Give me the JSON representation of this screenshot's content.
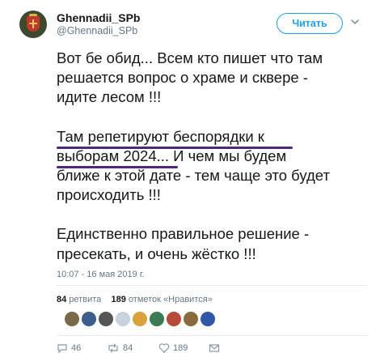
{
  "user": {
    "display_name": "Ghennadii_SPb",
    "handle": "@Ghennadii_SPb",
    "follow_label": "Читать"
  },
  "tweet": {
    "paragraph1": [
      "Вот бе обид... Всем кто пишет что там",
      "решается вопрос о храме и сквере -",
      "идите лесом !!!"
    ],
    "paragraph2": [
      "Там репетируют беспорядки к",
      "выборам 2024... И чем мы будем",
      "ближе к этой дате - тем чаще это будет",
      "происходить !!!"
    ],
    "paragraph3": [
      "Единственно правильное решение -",
      "пресекать, и очень жёстко !!!"
    ],
    "timestamp": "10:07 - 16 мая 2019 г."
  },
  "stats": {
    "retweets_count": "84",
    "retweets_label": "ретвита",
    "likes_count": "189",
    "likes_label": "отметок «Нравится»"
  },
  "likers": [
    {
      "icon": "liker-avatar",
      "color": "#7a6a4a"
    },
    {
      "icon": "liker-avatar",
      "color": "#3b5f8a"
    },
    {
      "icon": "liker-avatar",
      "color": "#555555"
    },
    {
      "icon": "liker-avatar",
      "color": "#c9d3de"
    },
    {
      "icon": "liker-avatar",
      "color": "#d9a23a"
    },
    {
      "icon": "liker-avatar",
      "color": "#3a7a55"
    },
    {
      "icon": "liker-avatar",
      "color": "#b84a3a"
    },
    {
      "icon": "liker-avatar",
      "color": "#8a6a3a"
    },
    {
      "icon": "liker-avatar",
      "color": "#2f56a8"
    }
  ],
  "actions": {
    "reply_count": "46",
    "retweet_count": "84",
    "like_count": "189"
  },
  "colors": {
    "accent": "#1da1f2",
    "underline": "#4b2a7b"
  }
}
